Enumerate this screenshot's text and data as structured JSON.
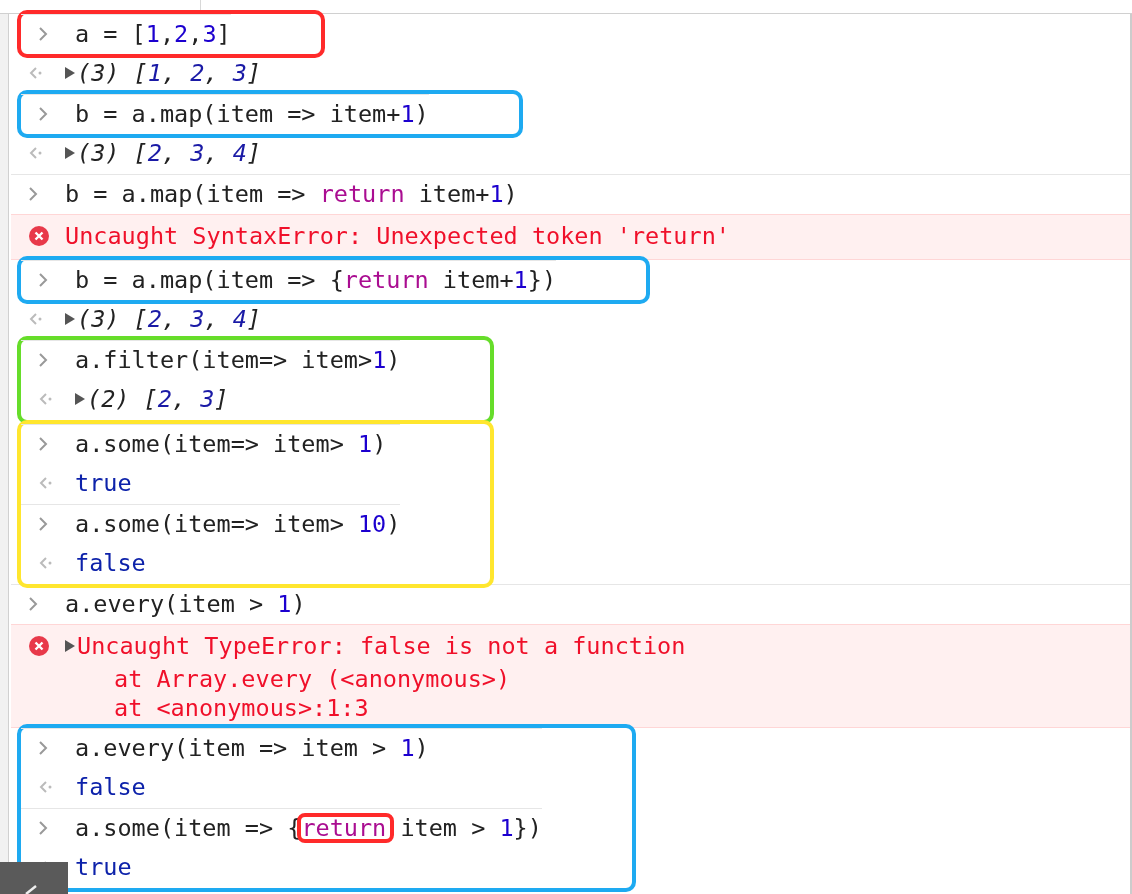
{
  "console": [
    {
      "color": "#ff2a2a",
      "entries": [
        {
          "kind": "input",
          "tokens": [
            {
              "text": "a = [",
              "kind": "plain"
            },
            {
              "text": "1",
              "kind": "number"
            },
            {
              "text": ",",
              "kind": "plain"
            },
            {
              "text": "2",
              "kind": "number"
            },
            {
              "text": ",",
              "kind": "plain"
            },
            {
              "text": "3",
              "kind": "number"
            },
            {
              "text": "]",
              "kind": "plain"
            }
          ]
        }
      ]
    },
    {
      "entries": [
        {
          "kind": "result",
          "expandable": true,
          "tokens": [
            {
              "text": "(3) [",
              "kind": "plain"
            },
            {
              "text": "1",
              "kind": "value"
            },
            {
              "text": ", ",
              "kind": "plain"
            },
            {
              "text": "2",
              "kind": "value"
            },
            {
              "text": ", ",
              "kind": "plain"
            },
            {
              "text": "3",
              "kind": "value"
            },
            {
              "text": "]",
              "kind": "plain"
            }
          ]
        }
      ]
    },
    {
      "color": "#1eaaf1",
      "entries": [
        {
          "kind": "input",
          "tokens": [
            {
              "text": "b = a.map(item => item+",
              "kind": "plain"
            },
            {
              "text": "1",
              "kind": "number"
            },
            {
              "text": ")",
              "kind": "plain"
            }
          ]
        }
      ]
    },
    {
      "entries": [
        {
          "kind": "result",
          "expandable": true,
          "tokens": [
            {
              "text": "(3) [",
              "kind": "plain"
            },
            {
              "text": "2",
              "kind": "value"
            },
            {
              "text": ", ",
              "kind": "plain"
            },
            {
              "text": "3",
              "kind": "value"
            },
            {
              "text": ", ",
              "kind": "plain"
            },
            {
              "text": "4",
              "kind": "value"
            },
            {
              "text": "]",
              "kind": "plain"
            }
          ]
        },
        {
          "kind": "input",
          "tokens": [
            {
              "text": "b = a.map(item => ",
              "kind": "plain"
            },
            {
              "text": "return",
              "kind": "keyword"
            },
            {
              "text": " item+",
              "kind": "plain"
            },
            {
              "text": "1",
              "kind": "number"
            },
            {
              "text": ")",
              "kind": "plain"
            }
          ]
        },
        {
          "kind": "error",
          "expandable": false,
          "lines": [
            "Uncaught SyntaxError: Unexpected token 'return'"
          ]
        }
      ]
    },
    {
      "color": "#1eaaf1",
      "entries": [
        {
          "kind": "input",
          "tokens": [
            {
              "text": "b = a.map(item => {",
              "kind": "plain"
            },
            {
              "text": "return",
              "kind": "keyword"
            },
            {
              "text": " item+",
              "kind": "plain"
            },
            {
              "text": "1",
              "kind": "number"
            },
            {
              "text": "})",
              "kind": "plain"
            }
          ]
        }
      ]
    },
    {
      "entries": [
        {
          "kind": "result",
          "expandable": true,
          "tokens": [
            {
              "text": "(3) [",
              "kind": "plain"
            },
            {
              "text": "2",
              "kind": "value"
            },
            {
              "text": ", ",
              "kind": "plain"
            },
            {
              "text": "3",
              "kind": "value"
            },
            {
              "text": ", ",
              "kind": "plain"
            },
            {
              "text": "4",
              "kind": "value"
            },
            {
              "text": "]",
              "kind": "plain"
            }
          ]
        }
      ]
    },
    {
      "color": "#66dd2a",
      "entries": [
        {
          "kind": "input",
          "tokens": [
            {
              "text": "a.filter(item=> item>",
              "kind": "plain"
            },
            {
              "text": "1",
              "kind": "number"
            },
            {
              "text": ")",
              "kind": "plain"
            }
          ]
        },
        {
          "kind": "result",
          "expandable": true,
          "tokens": [
            {
              "text": "(2) [",
              "kind": "plain"
            },
            {
              "text": "2",
              "kind": "value"
            },
            {
              "text": ", ",
              "kind": "plain"
            },
            {
              "text": "3",
              "kind": "value"
            },
            {
              "text": "]",
              "kind": "plain"
            }
          ]
        }
      ]
    },
    {
      "color": "#ffe62e",
      "entries": [
        {
          "kind": "input",
          "tokens": [
            {
              "text": "a.some(item=> item> ",
              "kind": "plain"
            },
            {
              "text": "1",
              "kind": "number"
            },
            {
              "text": ")",
              "kind": "plain"
            }
          ]
        },
        {
          "kind": "result",
          "expandable": false,
          "tokens": [
            {
              "text": "true",
              "kind": "boolean"
            }
          ]
        },
        {
          "kind": "input",
          "tokens": [
            {
              "text": "a.some(item=> item> ",
              "kind": "plain"
            },
            {
              "text": "10",
              "kind": "number"
            },
            {
              "text": ")",
              "kind": "plain"
            }
          ]
        },
        {
          "kind": "result",
          "expandable": false,
          "tokens": [
            {
              "text": "false",
              "kind": "boolean"
            }
          ]
        }
      ]
    },
    {
      "entries": [
        {
          "kind": "input",
          "tokens": [
            {
              "text": "a.every(item > ",
              "kind": "plain"
            },
            {
              "text": "1",
              "kind": "number"
            },
            {
              "text": ")",
              "kind": "plain"
            }
          ]
        },
        {
          "kind": "error",
          "expandable": true,
          "lines": [
            "Uncaught TypeError: false is not a function",
            "at Array.every (<anonymous>)",
            "at <anonymous>:1:3"
          ]
        }
      ]
    },
    {
      "color": "#1eaaf1",
      "entries": [
        {
          "kind": "input",
          "tokens": [
            {
              "text": "a.every(item => item > ",
              "kind": "plain"
            },
            {
              "text": "1",
              "kind": "number"
            },
            {
              "text": ")",
              "kind": "plain"
            }
          ]
        },
        {
          "kind": "result",
          "expandable": false,
          "tokens": [
            {
              "text": "false",
              "kind": "boolean"
            }
          ]
        },
        {
          "kind": "input",
          "tokens": [
            {
              "text": "a.some(item => {",
              "kind": "plain"
            },
            {
              "text": "return",
              "kind": "keyword",
              "frame": {
                "color": "#ff2a2a"
              }
            },
            {
              "text": " item > ",
              "kind": "plain"
            },
            {
              "text": "1",
              "kind": "number"
            },
            {
              "text": "})",
              "kind": "plain"
            }
          ]
        },
        {
          "kind": "result",
          "expandable": false,
          "tokens": [
            {
              "text": "true",
              "kind": "boolean"
            }
          ]
        }
      ]
    }
  ]
}
